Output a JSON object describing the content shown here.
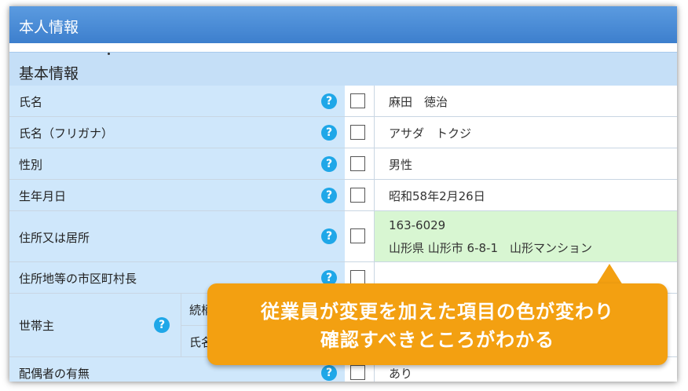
{
  "window": {
    "title": "本人情報"
  },
  "section": {
    "title": "基本情報"
  },
  "rows": [
    {
      "label": "氏名",
      "value": "麻田　徳治"
    },
    {
      "label": "氏名（フリガナ）",
      "value": "アサダ　トクジ"
    },
    {
      "label": "性別",
      "value": "男性"
    },
    {
      "label": "生年月日",
      "value": "昭和58年2月26日"
    },
    {
      "label": "住所又は居所",
      "value_line1": "163-6029",
      "value_line2": "山形県 山形市 6-8-1　山形マンション",
      "changed": true
    },
    {
      "label": "住所地等の市区町村長",
      "value": ""
    },
    {
      "label": "世帯主",
      "sub_labels": [
        "続柄",
        "氏名"
      ]
    },
    {
      "label": "配偶者の有無",
      "value": "あり"
    }
  ],
  "help_glyph": "?",
  "callout": {
    "line1": "従業員が変更を加えた項目の色が変わり",
    "line2": "確認すべきところがわかる"
  },
  "colors": {
    "title_bar": "#3d7fcd",
    "label_cell": "#cfe7fb",
    "changed_cell": "#d8f6d2",
    "help_icon": "#1fa7e8",
    "callout": "#f3a011"
  }
}
